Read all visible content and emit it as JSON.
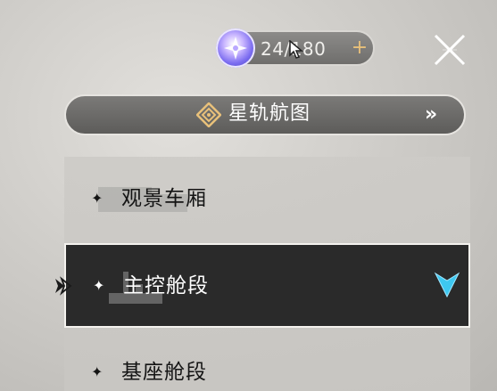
{
  "currency": {
    "icon": "star-rail-pass-icon",
    "count": "24/180",
    "plus": "+"
  },
  "close": {
    "icon": "close-icon"
  },
  "star_rail_map": {
    "icon": "compass-diamond-icon",
    "label": "星轨航图",
    "arrow": "»"
  },
  "sections": [
    {
      "label": "观景车厢",
      "selected": false
    },
    {
      "label": "主控舱段",
      "selected": true
    },
    {
      "label": "基座舱段",
      "selected": false
    }
  ],
  "colors": {
    "accent_gold": "#e8c07a",
    "location_cyan": "#3ec8f0",
    "selected_bg": "#2a2a2a"
  }
}
